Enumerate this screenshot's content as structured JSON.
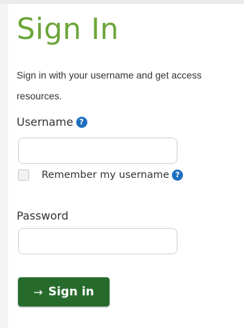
{
  "page": {
    "title": "Sign In",
    "intro": "Sign in with your username and get access resources."
  },
  "username": {
    "label": "Username",
    "help_icon": "?",
    "value": "",
    "placeholder": ""
  },
  "remember": {
    "label": "Remember my username",
    "checked": false,
    "help_icon": "?"
  },
  "password": {
    "label": "Password",
    "value": "",
    "placeholder": ""
  },
  "submit": {
    "arrow": "→",
    "label": "Sign in"
  },
  "colors": {
    "title_green": "#6ba539",
    "button_green": "#276b2c",
    "help_blue": "#1f6fbf"
  }
}
